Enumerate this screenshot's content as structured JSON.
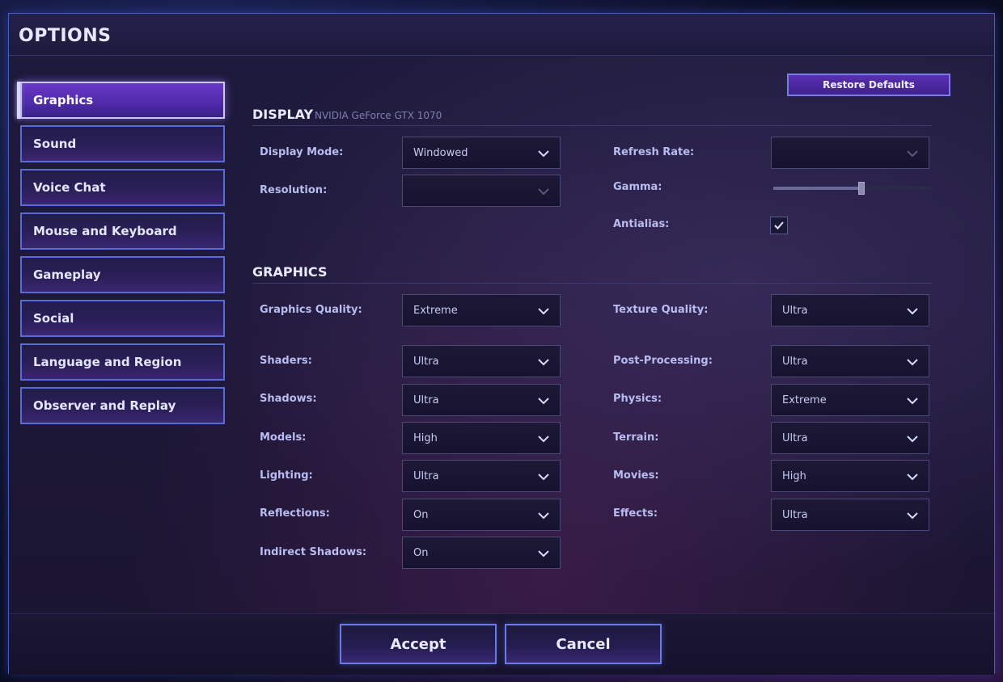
{
  "window": {
    "title": "OPTIONS"
  },
  "nav": {
    "items": [
      {
        "label": "Graphics",
        "active": true
      },
      {
        "label": "Sound"
      },
      {
        "label": "Voice Chat"
      },
      {
        "label": "Mouse and Keyboard"
      },
      {
        "label": "Gameplay"
      },
      {
        "label": "Social"
      },
      {
        "label": "Language and Region"
      },
      {
        "label": "Observer and Replay"
      }
    ]
  },
  "restore_defaults_label": "Restore Defaults",
  "display": {
    "title": "DISPLAY",
    "subtitle": "NVIDIA GeForce GTX 1070",
    "display_mode": {
      "label": "Display Mode:",
      "value": "Windowed"
    },
    "resolution": {
      "label": "Resolution:",
      "value": ""
    },
    "refresh_rate": {
      "label": "Refresh Rate:",
      "value": ""
    },
    "gamma": {
      "label": "Gamma:",
      "level": 0.56
    },
    "antialias": {
      "label": "Antialias:",
      "checked": true
    }
  },
  "graphics": {
    "title": "GRAPHICS",
    "graphics_quality": {
      "label": "Graphics Quality:",
      "value": "Extreme"
    },
    "texture_quality": {
      "label": "Texture Quality:",
      "value": "Ultra"
    },
    "shaders": {
      "label": "Shaders:",
      "value": "Ultra"
    },
    "post_processing": {
      "label": "Post-Processing:",
      "value": "Ultra"
    },
    "shadows": {
      "label": "Shadows:",
      "value": "Ultra"
    },
    "physics": {
      "label": "Physics:",
      "value": "Extreme"
    },
    "models": {
      "label": "Models:",
      "value": "High"
    },
    "terrain": {
      "label": "Terrain:",
      "value": "Ultra"
    },
    "lighting": {
      "label": "Lighting:",
      "value": "Ultra"
    },
    "movies": {
      "label": "Movies:",
      "value": "High"
    },
    "reflections": {
      "label": "Reflections:",
      "value": "On"
    },
    "effects": {
      "label": "Effects:",
      "value": "Ultra"
    },
    "indirect_shadows": {
      "label": "Indirect Shadows:",
      "value": "On"
    }
  },
  "footer": {
    "accept_label": "Accept",
    "cancel_label": "Cancel"
  },
  "colors": {
    "accent": "#5a6ad8",
    "active_tab": "#5e32c0",
    "panel_bg": "#1e1a3c",
    "text": "#c8ccf0"
  }
}
